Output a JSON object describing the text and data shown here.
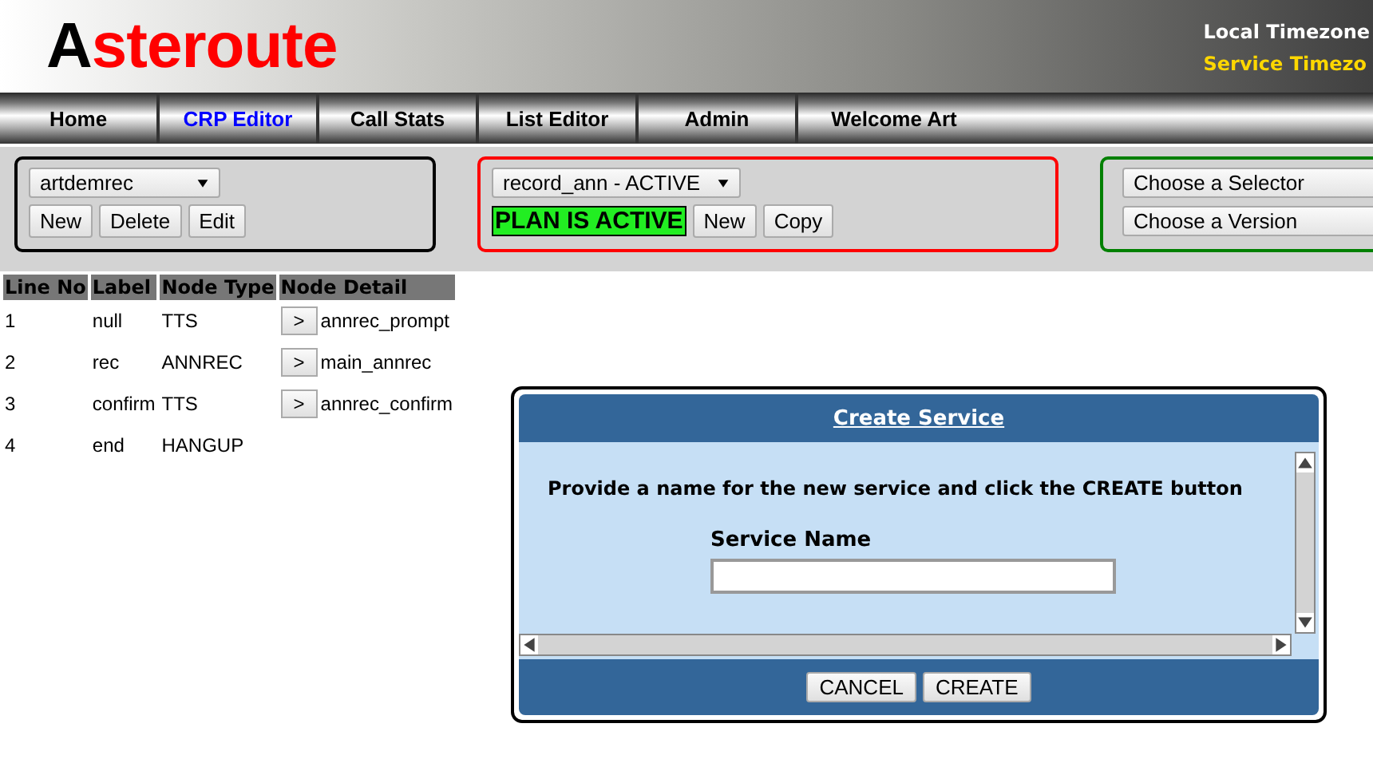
{
  "header": {
    "logo_first": "A",
    "logo_rest": "steroute",
    "timezones": [
      "Local Timezone",
      "Service Timezo"
    ]
  },
  "nav": [
    {
      "label": "Home",
      "selected": false
    },
    {
      "label": "CRP Editor",
      "selected": true
    },
    {
      "label": "Call Stats",
      "selected": false
    },
    {
      "label": "List Editor",
      "selected": false
    },
    {
      "label": "Admin",
      "selected": false
    },
    {
      "label": "Welcome Art",
      "selected": false
    }
  ],
  "panels": [
    {
      "color": "#000000",
      "selects": [
        "artdemrec"
      ],
      "buttons": [
        "New",
        "Delete",
        "Edit"
      ]
    },
    {
      "color": "#ff0000",
      "selects": [
        "record_ann - ACTIVE"
      ],
      "status": "PLAN IS ACTIVE",
      "buttons": [
        "New",
        "Copy"
      ]
    },
    {
      "color": "#008000",
      "selects": [
        "Choose a Selector",
        "Choose a Version"
      ]
    }
  ],
  "table": {
    "columns": [
      "Line No",
      "Label",
      "Node Type",
      "Node Detail"
    ],
    "rows": [
      {
        "cells": [
          "1",
          "null",
          "TTS",
          "annrec_prompt"
        ],
        "button": ">"
      },
      {
        "cells": [
          "2",
          "rec",
          "ANNREC",
          "main_annrec"
        ],
        "button": ">"
      },
      {
        "cells": [
          "3",
          "confirm",
          "TTS",
          "annrec_confirm"
        ],
        "button": ">"
      },
      {
        "cells": [
          "4",
          "end",
          "HANGUP",
          ""
        ]
      }
    ]
  },
  "dialog": {
    "title": "Create Service",
    "message": "Provide a name for the new service and click the CREATE button",
    "field_label": "Service Name",
    "buttons": [
      "CANCEL",
      "CREATE"
    ]
  }
}
